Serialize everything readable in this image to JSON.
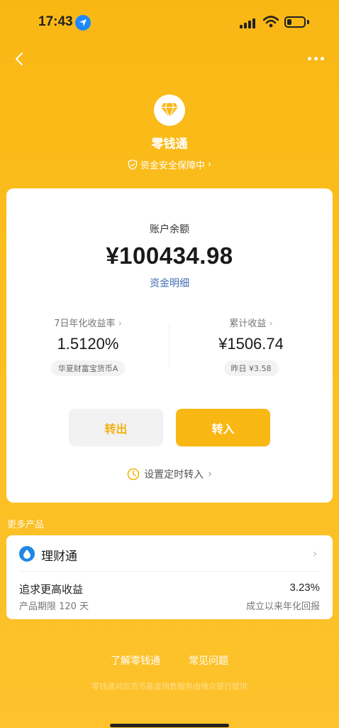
{
  "status_bar": {
    "time": "17:43"
  },
  "header": {
    "title": "零钱通",
    "security_text": "资金安全保障中"
  },
  "balance": {
    "label": "账户余额",
    "value": "¥100434.98",
    "detail_link": "资金明细"
  },
  "stats": {
    "yield_label": "7日年化收益率",
    "yield_value": "1.5120%",
    "fund_name": "华夏财富宝货币A",
    "income_label": "累计收益",
    "income_value": "¥1506.74",
    "yesterday": "昨日 ¥3.58"
  },
  "actions": {
    "transfer_out": "转出",
    "transfer_in": "转入",
    "scheduled": "设置定时转入"
  },
  "more_products": {
    "section_label": "更多产品",
    "product_name": "理财通",
    "description": "追求更高收益",
    "period": "产品期限 120 天",
    "rate": "3.23%",
    "rate_label": "成立以来年化回报"
  },
  "footer": {
    "learn": "了解零钱通",
    "faq": "常见问题",
    "note": "零钱通对应货币基金销售服务由微众银行提供"
  },
  "colors": {
    "brand": "#f9b714",
    "link": "#3f6db3",
    "product_icon": "#1e88e5"
  }
}
